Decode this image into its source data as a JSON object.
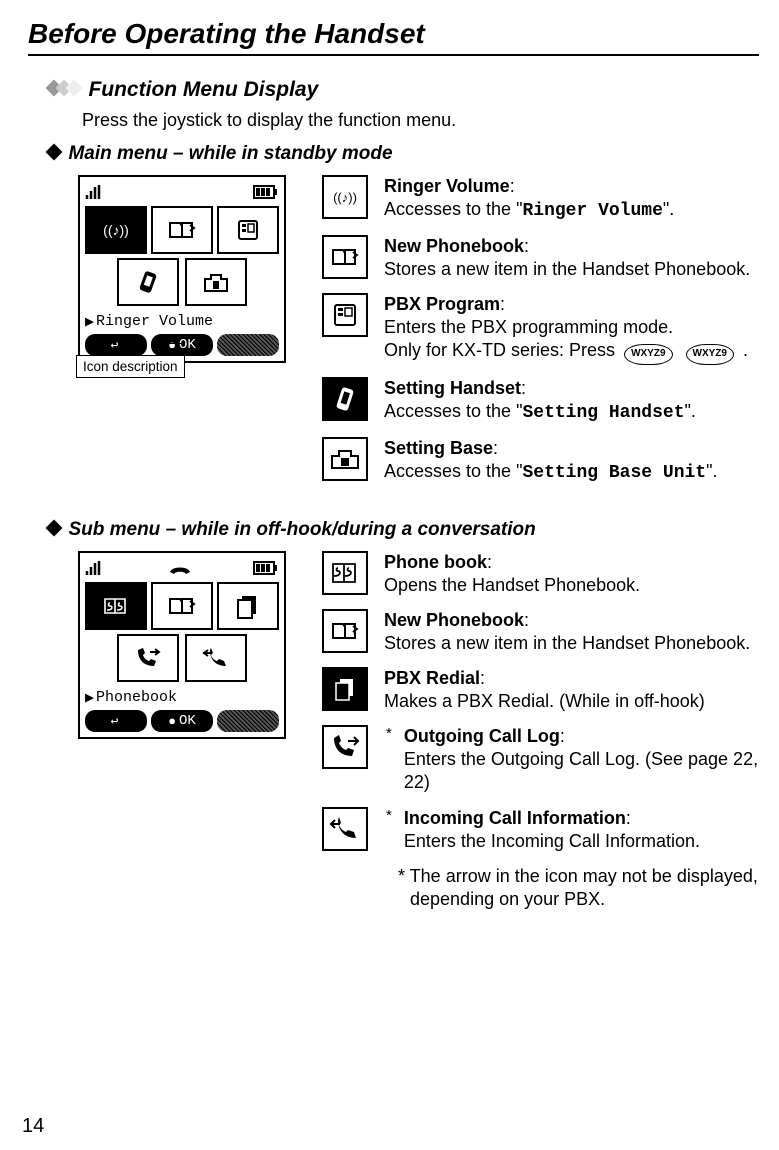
{
  "page_title": "Before Operating the Handset",
  "page_number": "14",
  "function_menu": {
    "heading": "Function Menu Display",
    "intro": "Press the joystick to display the function menu."
  },
  "main_menu": {
    "heading": "Main menu – while in standby mode",
    "screenshot_label": "Ringer Volume",
    "callout_label": "Icon description",
    "softkeys": {
      "left": "↩",
      "center": "OK",
      "right": ""
    },
    "items": [
      {
        "term": "Ringer Volume",
        "body_a": "Accesses to the \"",
        "mono": "Ringer Volume",
        "body_b": "\"."
      },
      {
        "term": "New Phonebook",
        "body_a": "Stores a new item in the Handset Phonebook."
      },
      {
        "term": "PBX Program",
        "body_a": "Enters the PBX programming mode.",
        "body_extra": "Only for KX-TD series: Press",
        "key1": "WXYZ9",
        "key2": "WXYZ9",
        "body_tail": "."
      },
      {
        "term": "Setting Handset",
        "body_a": "Accesses to the \"",
        "mono": "Setting Handset",
        "body_b": "\"."
      },
      {
        "term": "Setting Base",
        "body_a": "Accesses to the \"",
        "mono": "Setting Base Unit",
        "body_b": "\"."
      }
    ]
  },
  "sub_menu": {
    "heading": "Sub menu – while in off-hook/during a conversation",
    "screenshot_label": "Phonebook",
    "softkeys": {
      "left": "↩",
      "center": "OK",
      "right": ""
    },
    "items": [
      {
        "term": "Phone book",
        "body_a": "Opens the Handset Phonebook."
      },
      {
        "term": "New Phonebook",
        "body_a": "Stores a new item in the Handset Phonebook."
      },
      {
        "term": "PBX Redial",
        "body_a": "Makes a PBX Redial. (While in off-hook)"
      },
      {
        "term": "Outgoing Call Log",
        "body_a": "Enters the Outgoing Call Log. (See page 22, 22)",
        "star": "*"
      },
      {
        "term": "Incoming Call Information",
        "body_a": "Enters the Incoming Call Information.",
        "star": "*"
      }
    ],
    "footnote": "* The arrow in the icon may not be displayed, depending on your PBX."
  }
}
